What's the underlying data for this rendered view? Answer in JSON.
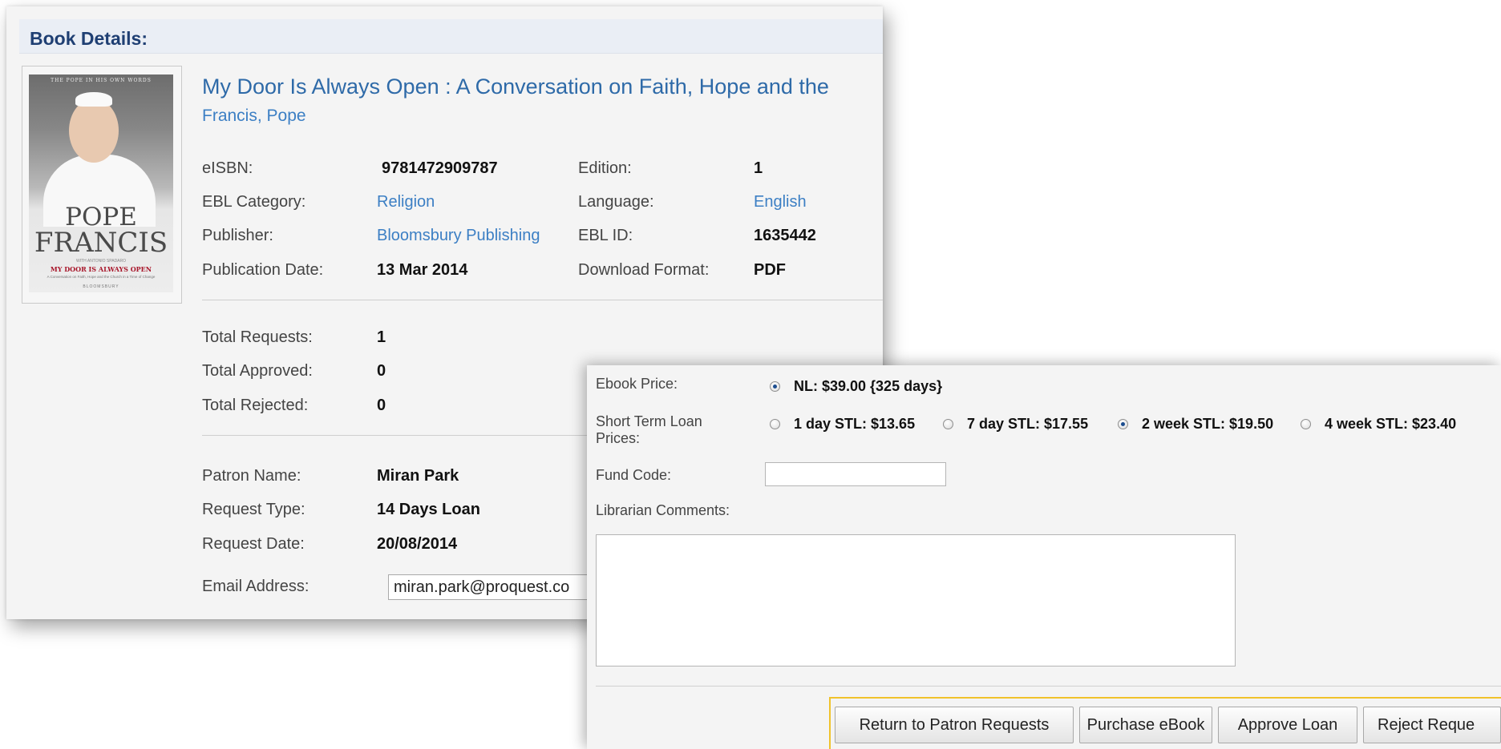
{
  "book_details": {
    "header": "Book Details:",
    "cover": {
      "top_text": "THE POPE IN HIS OWN WORDS",
      "line_pope": "POPE",
      "line_francis": "FRANCIS",
      "small_line": "WITH ANTONIO SPADARO",
      "subtitle": "MY DOOR IS ALWAYS OPEN",
      "small_line2": "A Conversation on Faith, Hope and the Church in a Time of Change",
      "publisher_mark": "BLOOMSBURY"
    },
    "title": "My Door Is Always Open : A Conversation on Faith, Hope and the",
    "author": "Francis, Pope",
    "meta": {
      "eisbn_label": "eISBN:",
      "eisbn_value": "9781472909787",
      "category_label": "EBL Category:",
      "category_value": "Religion",
      "publisher_label": "Publisher:",
      "publisher_value": "Bloomsbury Publishing",
      "pubdate_label": "Publication Date:",
      "pubdate_value": "13 Mar 2014",
      "edition_label": "Edition:",
      "edition_value": "1",
      "language_label": "Language:",
      "language_value": "English",
      "eblid_label": "EBL ID:",
      "eblid_value": "1635442",
      "format_label": "Download Format:",
      "format_value": "PDF"
    },
    "stats": {
      "total_requests_label": "Total Requests:",
      "total_requests_value": "1",
      "total_approved_label": "Total Approved:",
      "total_approved_value": "0",
      "total_rejected_label": "Total Rejected:",
      "total_rejected_value": "0"
    },
    "patron": {
      "name_label": "Patron Name:",
      "name_value": "Miran Park",
      "type_label": "Request Type:",
      "type_value": "14 Days Loan",
      "date_label": "Request Date:",
      "date_value": "20/08/2014",
      "email_label": "Email Address:",
      "email_value": "miran.park@proquest.co"
    }
  },
  "purchase_form": {
    "ebook_price_label": "Ebook Price:",
    "ebook_price_option": "NL: $39.00 {325 days}",
    "stl_label": "Short Term Loan Prices:",
    "stl_options": [
      {
        "label": "1 day STL: $13.65",
        "selected": false
      },
      {
        "label": "7 day STL: $17.55",
        "selected": false
      },
      {
        "label": "2 week STL: $19.50",
        "selected": true
      },
      {
        "label": "4 week STL: $23.40",
        "selected": false
      }
    ],
    "fund_code_label": "Fund Code:",
    "fund_code_value": "",
    "comments_label": "Librarian Comments:",
    "comments_value": "",
    "buttons": {
      "return": "Return to Patron Requests",
      "purchase": "Purchase eBook",
      "approve": "Approve Loan",
      "reject": "Reject Reque"
    },
    "highlight_color": "#f0c22b"
  }
}
